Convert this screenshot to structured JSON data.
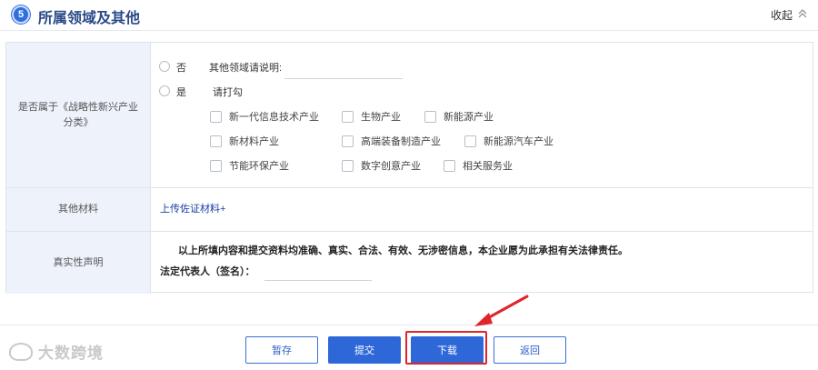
{
  "section": {
    "number": "5",
    "title": "所属领域及其他",
    "collapse_label": "收起"
  },
  "rows": {
    "industry": {
      "label": "是否属于《战略性新兴产业分类》",
      "no_label": "否",
      "other_field_label": "其他领域请说明:",
      "yes_label": "是",
      "check_hint": "请打勾",
      "options": [
        "新一代信息技术产业",
        "生物产业",
        "新能源产业",
        "新材料产业",
        "高端装备制造产业",
        "新能源汽车产业",
        "节能环保产业",
        "数字创意产业",
        "相关服务业"
      ]
    },
    "materials": {
      "label": "其他材料",
      "upload_link": "上传佐证材料+"
    },
    "declaration": {
      "label": "真实性声明",
      "text": "以上所填内容和提交资料均准确、真实、合法、有效、无涉密信息，本企业愿为此承担有关法律责任。",
      "signature_label": "法定代表人（签名）："
    }
  },
  "buttons": {
    "save_draft": "暂存",
    "submit": "提交",
    "download": "下载",
    "back": "返回"
  },
  "watermark": "大数跨境",
  "colors": {
    "accent": "#2e68d8",
    "highlight": "#e0242a",
    "label_bg": "#eef3fb"
  }
}
